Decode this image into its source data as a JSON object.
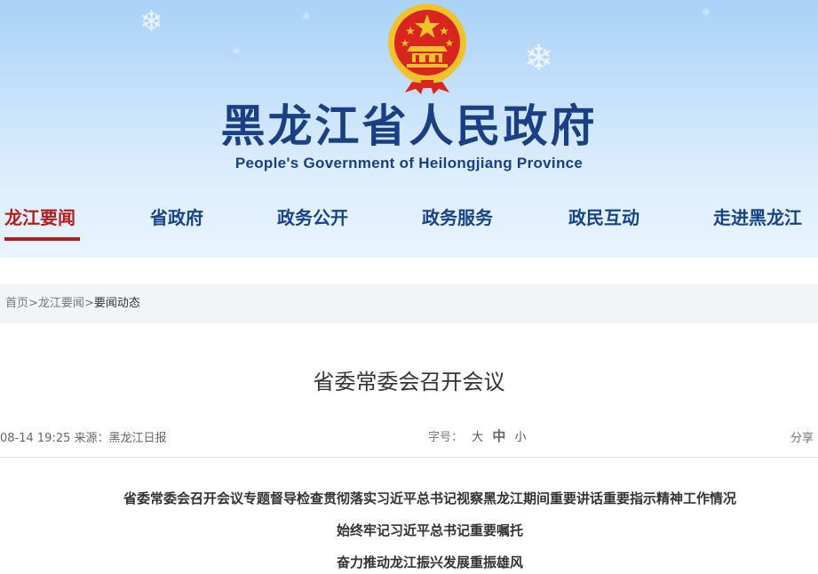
{
  "header": {
    "site_title": "黑龙江省人民政府",
    "site_subtitle": "People's Government of Heilongjiang Province"
  },
  "nav": {
    "items": [
      {
        "label": "龙江要闻",
        "active": true
      },
      {
        "label": "省政府",
        "active": false
      },
      {
        "label": "政务公开",
        "active": false
      },
      {
        "label": "政务服务",
        "active": false
      },
      {
        "label": "政民互动",
        "active": false
      },
      {
        "label": "走进黑龙江",
        "active": false
      }
    ]
  },
  "breadcrumb": {
    "items": [
      "首页",
      "龙江要闻",
      "要闻动态"
    ],
    "separator": ">"
  },
  "article": {
    "title": "省委常委会召开会议",
    "meta": "08-14 19:25 来源：黑龙江日报",
    "font_size_label": "字号：",
    "font_sizes": [
      "大",
      "中",
      "小"
    ],
    "share_label": "分享",
    "headlines": [
      "省委常委会召开会议专题督导检查贯彻落实习近平总书记视察黑龙江期间重要讲话重要指示精神工作情况",
      "始终牢记习近平总书记重要嘱托",
      "奋力推动龙江振兴发展重振雄风"
    ]
  },
  "colors": {
    "nav_text": "#174487",
    "nav_active": "#b21e1e",
    "title_blue": "#1a3f82",
    "emblem_red": "#d8251d",
    "emblem_gold": "#f2c12e"
  }
}
